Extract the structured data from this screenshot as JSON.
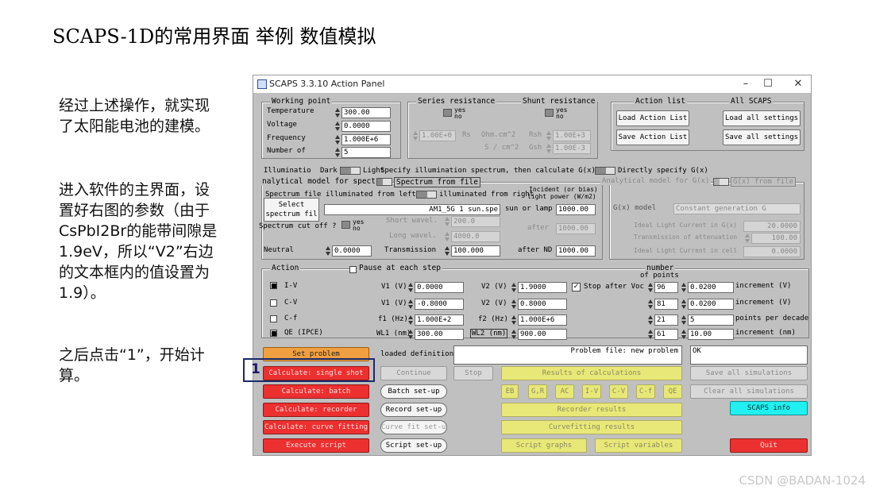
{
  "slide": {
    "title": "SCAPS-1D的常用界面  举例  数值模拟",
    "note1": "经过上述操作，就实现了太阳能电池的建模。",
    "note2": "进入软件的主界面，设置好右图的参数（由于CsPbI2Br的能带间隙是1.9eV，所以“V2”右边的文本框内的值设置为1.9）。",
    "note3": "之后点击“1”，开始计算。",
    "callout_number": "1",
    "watermark": "CSDN @BADAN-1024"
  },
  "window": {
    "title": "SCAPS 3.3.10 Action Panel",
    "controls": [
      "–",
      "☐",
      "✕"
    ]
  },
  "working_point": {
    "group_title": "Working point",
    "rows": [
      {
        "label": "Temperature",
        "value": "300.00"
      },
      {
        "label": "Voltage",
        "value": "0.0000"
      },
      {
        "label": "Frequency",
        "value": "1.000E+6"
      },
      {
        "label": "Number of",
        "value": "5"
      }
    ]
  },
  "resistance": {
    "series_title": "Series resistance",
    "shunt_title": "Shunt resistance",
    "yes": "yes",
    "no": "no",
    "rs_value": "1.00E+0",
    "rs_label": "Rs",
    "rs_unit": "Ohm.cm^2",
    "rsh_label": "Rsh",
    "rsh_value": "1.00E+3",
    "s_unit": "S / cm^2",
    "gsh_label": "Gsh",
    "gsh_value": "1.00E-3"
  },
  "action_list": {
    "group_title": "Action list",
    "all_scaps": "All SCAPS",
    "load_action_list": "Load Action List",
    "load_all_settings": "Load all settings",
    "save_action_list": "Save Action List",
    "save_all_settings": "Save all settings"
  },
  "illumination": {
    "label": "Illuminatio",
    "dark": "Dark",
    "light": "Light",
    "specify_spectrum": "Specify illumination spectrum, then calculate G(x)",
    "directly_specify": "Directly specify G(x)",
    "analytical_model": "nalytical model for spectrum",
    "spectrum_from_file": "Spectrum from file",
    "analytical_gx": "Analytical model for G(x)",
    "gx_from_file": "G(x) from file",
    "spectrum_file_label": "Spectrum file",
    "select_button": "Select",
    "spectrum_file_text": "spectrum fil",
    "illum_from_left": "illuminated from left",
    "illum_from_right": "illuminated from right",
    "incident_label": "Incident (or bias)",
    "light_power_label": "light power (W/m2)",
    "spectrum_name": "AM1_5G 1 sun.spe",
    "sun_or_lamp": "sun or lamp",
    "sun_or_lamp_value": "1000.00",
    "spectrum_cut_off": "Spectrum cut off ?",
    "yes": "yes",
    "no": "no",
    "short_wavel": "Short wavel.",
    "short_wavel_value": "200.0",
    "after": "after",
    "after_value": "1000.00",
    "long_wavel": "Long wavel.",
    "long_wavel_value": "4000.0",
    "neutral": "Neutral",
    "neutral_value": "0.0000",
    "transmission": "Transmission",
    "transmission_value": "100.000",
    "after_nd": "after ND",
    "after_nd_value": "1000.00",
    "gx_model_label": "G(x) model",
    "gx_model_value": "Constant generation G",
    "ideal_light_current": "Ideal Light Current in G(x)",
    "ideal_light_current_value": "20.0000",
    "transmission_attenuation": "Transmission of attenuation",
    "transmission_attenuation_value": "100.00",
    "ideal_light_cell": "Ideal Light Current in cell",
    "ideal_light_cell_value": "0.0000"
  },
  "action": {
    "group_title": "Action",
    "pause_label": "Pause at each step",
    "number_label": "number",
    "of_points_label": "of points",
    "rows": [
      {
        "name": "I-V",
        "checked": true,
        "p1_label": "V1 (V)",
        "p1": "0.0000",
        "p2_label": "V2 (V)",
        "p2": "1.9000",
        "n": "96",
        "inc": "0.0200",
        "inc_label": "increment (V)"
      },
      {
        "name": "C-V",
        "checked": false,
        "p1_label": "V1 (V)",
        "p1": "-0.8000",
        "p2_label": "V2 (V)",
        "p2": "0.8000",
        "n": "81",
        "inc": "0.0200",
        "inc_label": "increment (V)"
      },
      {
        "name": "C-f",
        "checked": false,
        "p1_label": "f1 (Hz)",
        "p1": "1.000E+2",
        "p2_label": "f2 (Hz)",
        "p2": "1.000E+6",
        "n": "21",
        "inc": "5",
        "inc_label": "points per decade"
      },
      {
        "name": "QE (IPCE)",
        "checked": true,
        "p1_label": "WL1 (nm)",
        "p1": "300.00",
        "p2_label": "WL2 (nm)",
        "p2": "900.00",
        "n": "61",
        "inc": "10.00",
        "inc_label": "increment (nm)"
      }
    ],
    "stop_after_voc": "Stop after Voc"
  },
  "bottom": {
    "set_problem": "Set problem",
    "loaded_definition": "loaded definition file:",
    "problem_file": "Problem file: new problem",
    "ok": "OK",
    "calc_single": "Calculate: single shot",
    "continue": "Continue",
    "stop": "Stop",
    "results": "Results of calculations",
    "save_all_sim": "Save all simulations",
    "calc_batch": "Calculate: batch",
    "batch_setup": "Batch set-up",
    "result_buttons": [
      "EB",
      "G,R",
      "AC",
      "I-V",
      "C-V",
      "C-f",
      "QE"
    ],
    "clear_all_sim": "Clear all simulations",
    "calc_recorder": "Calculate: recorder",
    "record_setup": "Record set-up",
    "recorder_results": "Recorder results",
    "scaps_info": "SCAPS info",
    "calc_curve": "Calculate: curve fitting",
    "curve_fit_setup": "Curve fit set-up",
    "curvefitting_results": "Curvefitting results",
    "execute_script": "Execute script",
    "script_setup": "Script set-up",
    "script_graphs": "Script graphs",
    "script_variables": "Script variables",
    "quit": "Quit"
  }
}
